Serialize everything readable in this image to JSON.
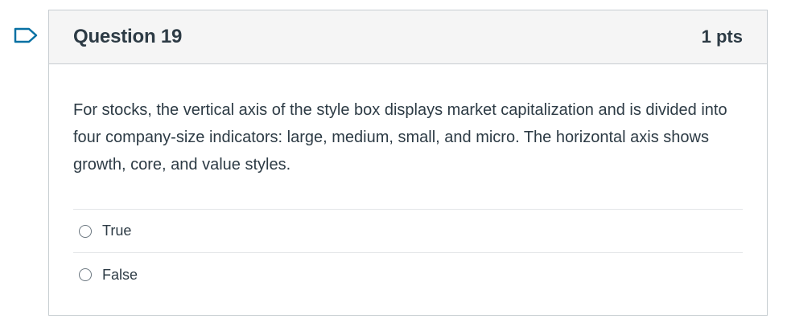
{
  "question": {
    "title": "Question 19",
    "points": "1 pts",
    "text": "For stocks, the vertical axis of the style box displays market capitalization and is divided into four company-size indicators: large, medium, small, and micro. The horizontal axis shows growth, core, and value styles.",
    "flag_icon": "flag-icon",
    "accent_color": "#0770a3",
    "answers": [
      {
        "label": "True",
        "selected": false
      },
      {
        "label": "False",
        "selected": false
      }
    ]
  }
}
